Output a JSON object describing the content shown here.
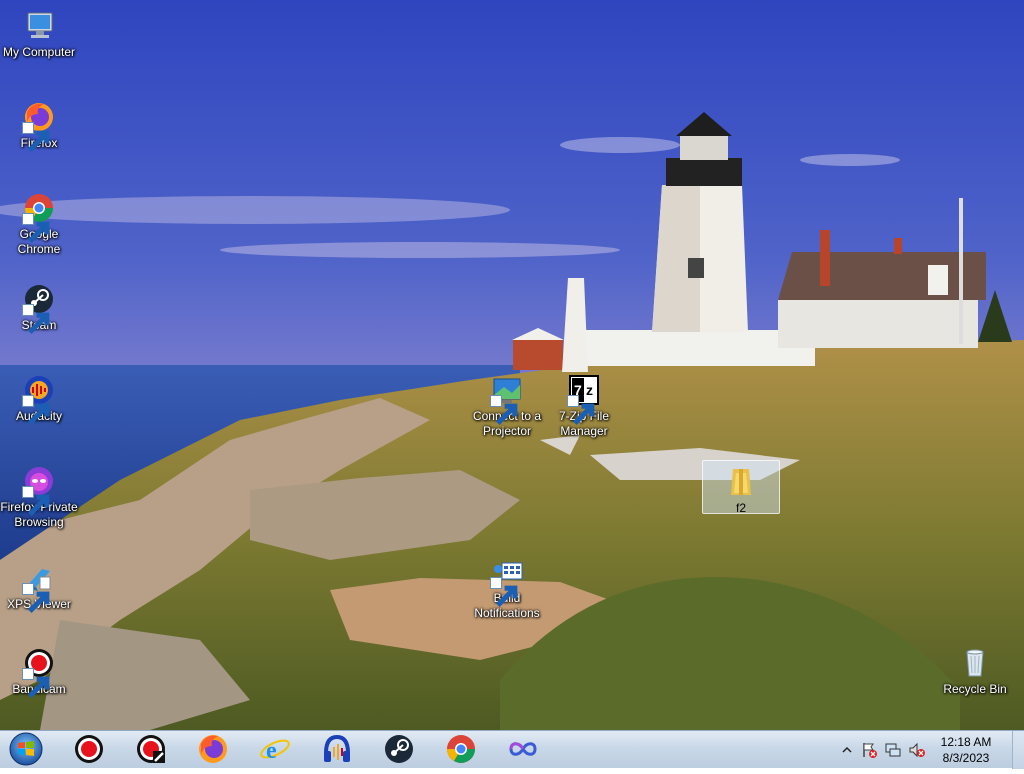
{
  "desktop": {
    "icons": [
      {
        "label": "My Computer",
        "icon": "computer-icon",
        "shortcut": false
      },
      {
        "label": "Firefox",
        "icon": "firefox-icon",
        "shortcut": true
      },
      {
        "label": "Google Chrome",
        "icon": "chrome-icon",
        "shortcut": true
      },
      {
        "label": "Steam",
        "icon": "steam-icon",
        "shortcut": true
      },
      {
        "label": "Audacity",
        "icon": "audacity-icon",
        "shortcut": true
      },
      {
        "label": "Firefox Private Browsing",
        "icon": "firefox-private-icon",
        "shortcut": true
      },
      {
        "label": "XPS Viewer",
        "icon": "xps-viewer-icon",
        "shortcut": true
      },
      {
        "label": "Bandicam",
        "icon": "bandicam-icon",
        "shortcut": true
      },
      {
        "label": "Connect to a Projector",
        "icon": "projector-icon",
        "shortcut": true
      },
      {
        "label": "7-Zip File Manager",
        "icon": "7zip-icon",
        "shortcut": true
      },
      {
        "label": "f2",
        "icon": "folder-icon",
        "shortcut": false,
        "selected": true
      },
      {
        "label": "Build Notifications",
        "icon": "build-notifications-icon",
        "shortcut": true
      },
      {
        "label": "Recycle Bin",
        "icon": "recycle-bin-icon",
        "shortcut": false
      }
    ]
  },
  "taskbar": {
    "start": {
      "icon": "windows-start-icon"
    },
    "pinned": [
      {
        "name": "Bandicam",
        "icon": "bandicam-icon"
      },
      {
        "name": "Bandicam Tool",
        "icon": "bandicam-tool-icon"
      },
      {
        "name": "Firefox",
        "icon": "firefox-icon"
      },
      {
        "name": "Internet Explorer",
        "icon": "internet-explorer-icon"
      },
      {
        "name": "Audacity",
        "icon": "audacity-icon"
      },
      {
        "name": "Steam",
        "icon": "steam-icon"
      },
      {
        "name": "Google Chrome",
        "icon": "chrome-icon"
      },
      {
        "name": "Infinity",
        "icon": "infinity-icon"
      }
    ],
    "tray": {
      "icons": [
        "show-hidden-icons-chevron",
        "action-center-flag-icon",
        "network-icon",
        "volume-muted-icon"
      ],
      "time": "12:18 AM",
      "date": "8/3/2023"
    }
  },
  "colors": {
    "taskbar": "#c9d8e8",
    "sky_top": "#3a4fc0",
    "sea": "#2d4a9a"
  }
}
